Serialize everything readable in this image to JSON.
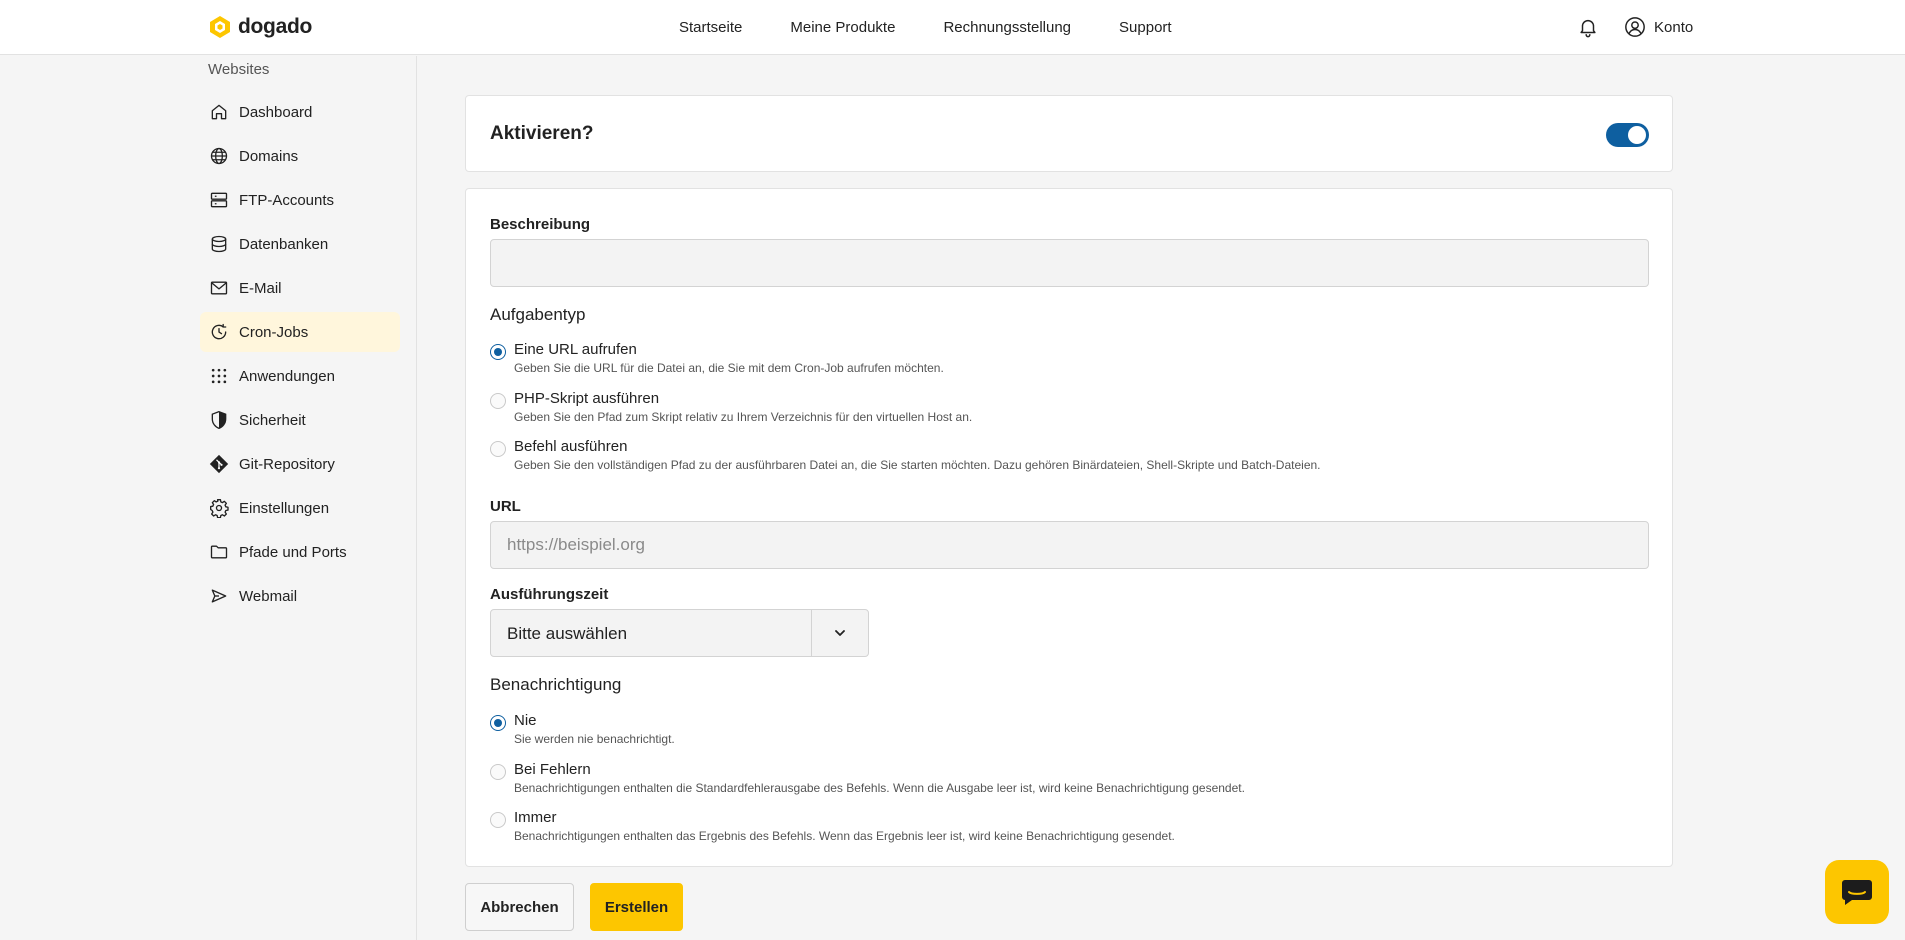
{
  "brand": {
    "name": "dogado",
    "accent": "#fdc600",
    "primary": "#0e5fa0"
  },
  "nav": {
    "items": [
      "Startseite",
      "Meine Produkte",
      "Rechnungsstellung",
      "Support"
    ],
    "notification_icon": "bell-icon",
    "account_label": "Konto"
  },
  "sidebar": {
    "heading": "Websites",
    "items": [
      {
        "label": "Dashboard",
        "icon": "home-icon"
      },
      {
        "label": "Domains",
        "icon": "globe-icon"
      },
      {
        "label": "FTP-Accounts",
        "icon": "server-icon"
      },
      {
        "label": "Datenbanken",
        "icon": "database-icon"
      },
      {
        "label": "E-Mail",
        "icon": "mail-icon"
      },
      {
        "label": "Cron-Jobs",
        "icon": "cron-clock-icon",
        "active": true
      },
      {
        "label": "Anwendungen",
        "icon": "grid-icon"
      },
      {
        "label": "Sicherheit",
        "icon": "shield-icon"
      },
      {
        "label": "Git-Repository",
        "icon": "git-icon"
      },
      {
        "label": "Einstellungen",
        "icon": "gear-icon"
      },
      {
        "label": "Pfade und Ports",
        "icon": "folder-icon"
      },
      {
        "label": "Webmail",
        "icon": "send-icon"
      }
    ]
  },
  "activate": {
    "label": "Aktivieren?",
    "enabled": true
  },
  "form": {
    "description": {
      "label": "Beschreibung",
      "value": ""
    },
    "task_type": {
      "title": "Aufgabentyp",
      "options": [
        {
          "label": "Eine URL aufrufen",
          "desc": "Geben Sie die URL für die Datei an, die Sie mit dem Cron-Job aufrufen möchten.",
          "checked": true
        },
        {
          "label": "PHP-Skript ausführen",
          "desc": "Geben Sie den Pfad zum Skript relativ zu Ihrem Verzeichnis für den virtuellen Host an.",
          "checked": false
        },
        {
          "label": "Befehl ausführen",
          "desc": "Geben Sie den vollständigen Pfad zu der ausführbaren Datei an, die Sie starten möchten. Dazu gehören Binärdateien, Shell-Skripte und Batch-Dateien.",
          "checked": false
        }
      ]
    },
    "url": {
      "label": "URL",
      "placeholder": "https://beispiel.org",
      "value": ""
    },
    "exec_time": {
      "label": "Ausführungszeit",
      "selected": "Bitte auswählen"
    },
    "notification": {
      "title": "Benachrichtigung",
      "options": [
        {
          "label": "Nie",
          "desc": "Sie werden nie benachrichtigt.",
          "checked": true
        },
        {
          "label": "Bei Fehlern",
          "desc": "Benachrichtigungen enthalten die Standardfehlerausgabe des Befehls. Wenn die Ausgabe leer ist, wird keine Benachrichtigung gesendet.",
          "checked": false
        },
        {
          "label": "Immer",
          "desc": "Benachrichtigungen enthalten das Ergebnis des Befehls. Wenn das Ergebnis leer ist, wird keine Benachrichtigung gesendet.",
          "checked": false
        }
      ]
    }
  },
  "actions": {
    "cancel": "Abbrechen",
    "create": "Erstellen"
  },
  "help": {
    "icon": "chat-icon"
  }
}
